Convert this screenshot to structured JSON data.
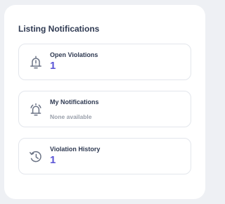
{
  "panel": {
    "title": "Listing Notifications"
  },
  "cards": [
    {
      "icon": "bell-alert-icon",
      "label": "Open Violations",
      "value": "1"
    },
    {
      "icon": "bell-ringing-icon",
      "label": "My Notifications",
      "subtext": "None available"
    },
    {
      "icon": "history-icon",
      "label": "Violation History",
      "value": "1"
    }
  ],
  "colors": {
    "accent": "#5b55d6",
    "title_text": "#2f3a52",
    "muted_text": "#9aa0ab",
    "icon": "#6b7385",
    "card_border": "#e3e6ec",
    "background": "#eef0f4"
  }
}
